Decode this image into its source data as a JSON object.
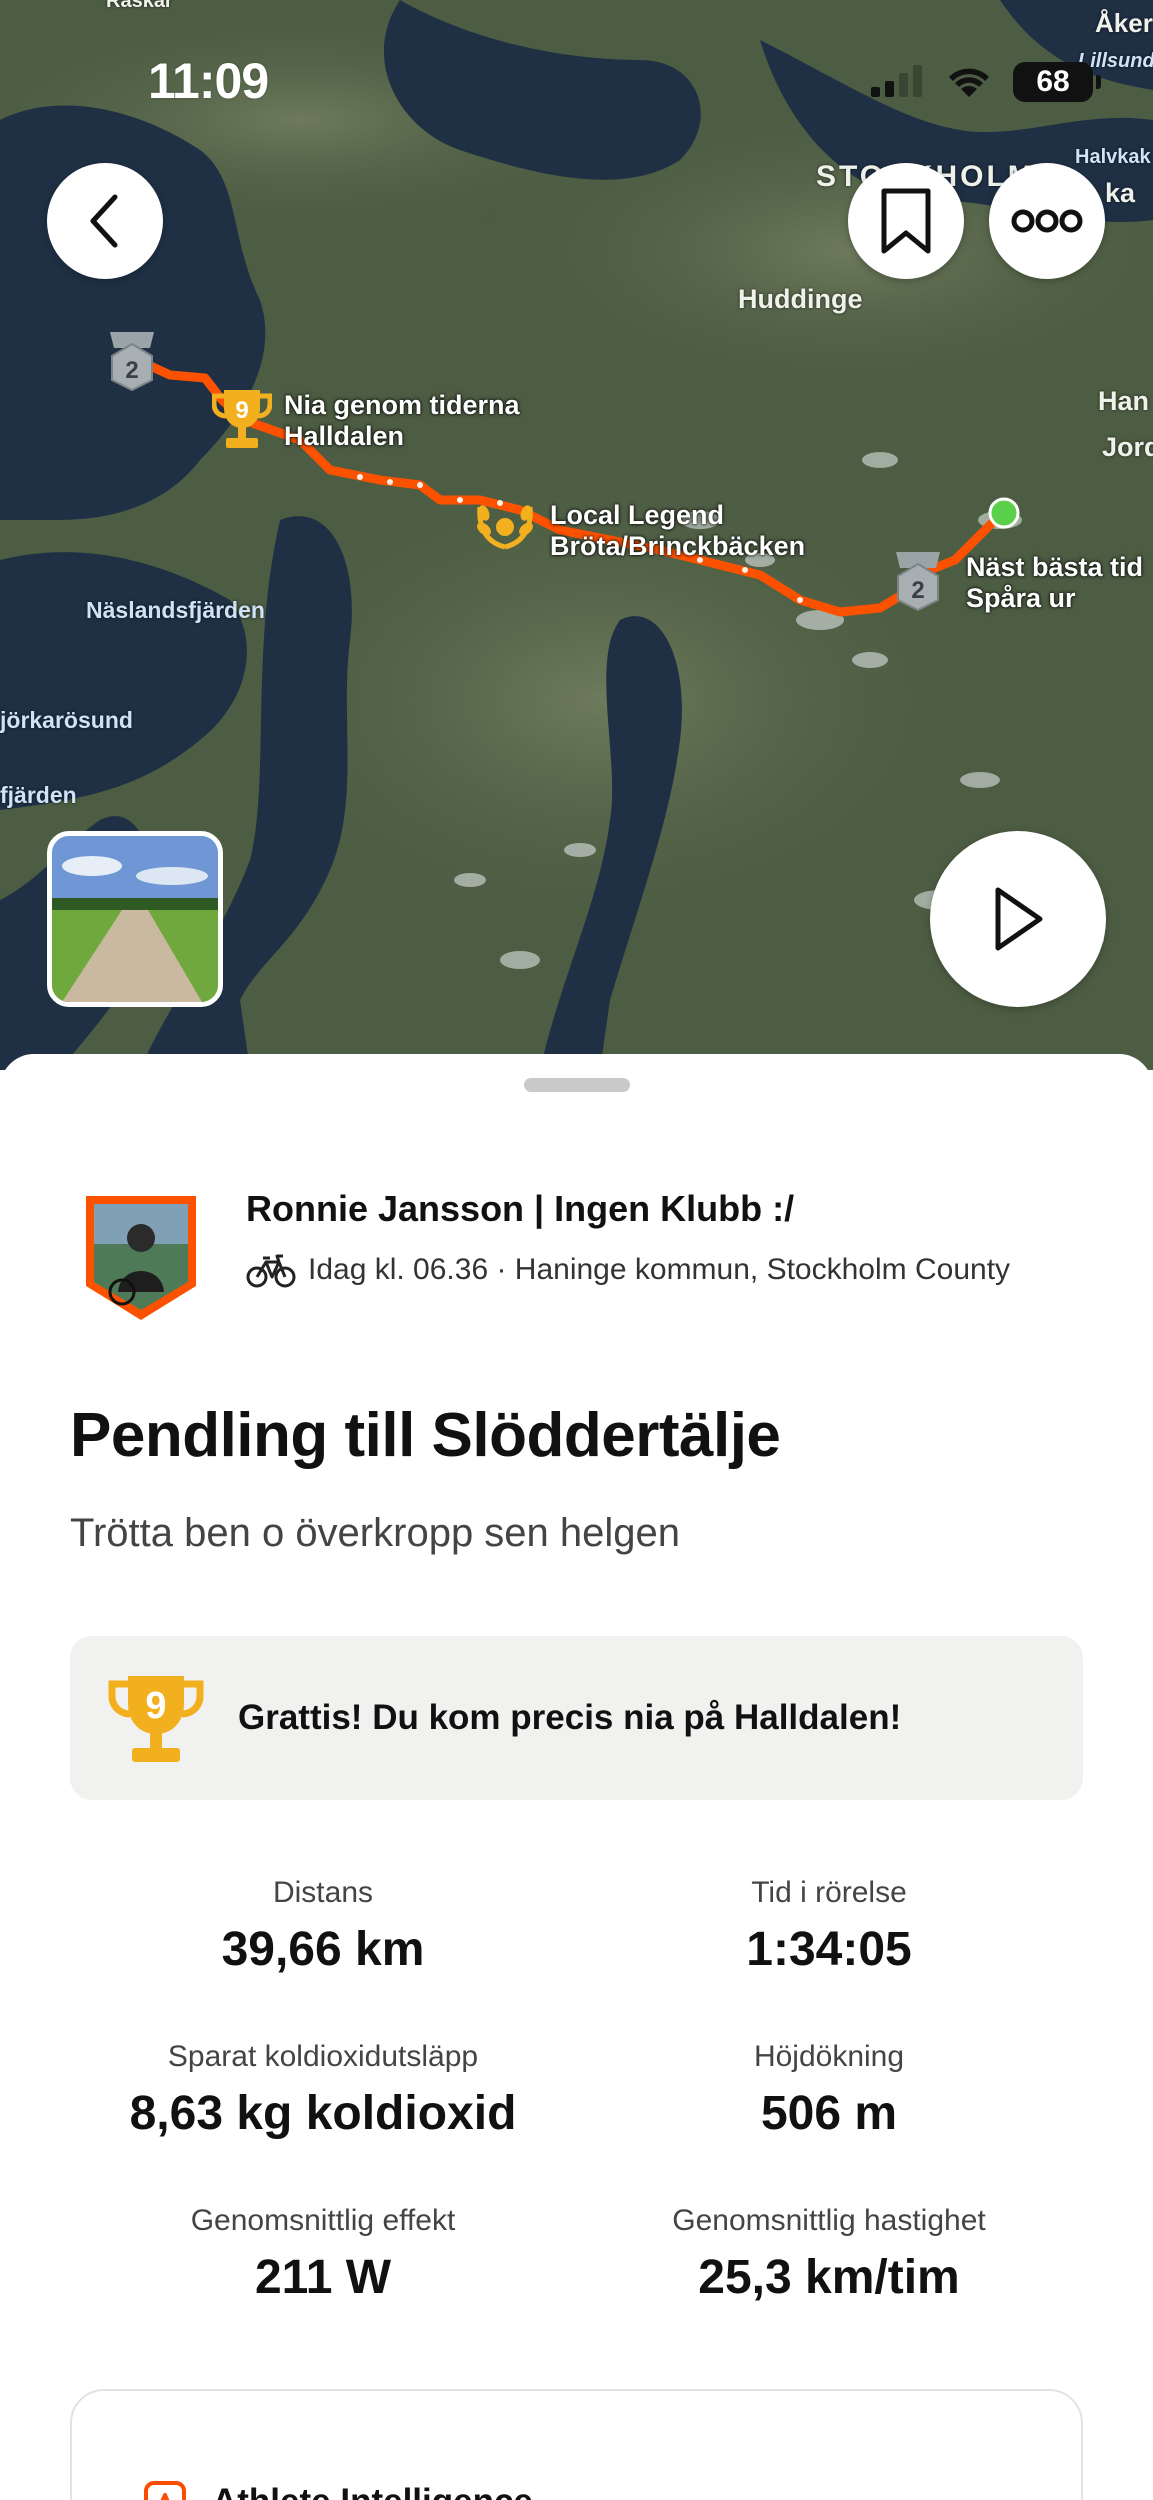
{
  "status_bar": {
    "time": "11:09",
    "battery": "68"
  },
  "map": {
    "labels": {
      "raskar": "Raskar",
      "akers": "Åker",
      "lillsunds": "Lillsund",
      "halvkakan": "Halvkak",
      "ka": "ka",
      "stockholm": "STOCKHOLM",
      "huddinge": "Huddinge",
      "han": "Han",
      "jord": "Jord",
      "naslandsfjarden": "Näslandsfjärden",
      "jorkarosund": "jörkarösund",
      "fjarden": "fjärden"
    },
    "segments": {
      "nia_line1": "Nia genom tiderna",
      "nia_line2": "Halldalen",
      "legend_line1": "Local Legend",
      "legend_line2": "Bröta/Brinckbäcken",
      "nast_line1": "Näst bästa tid",
      "nast_line2": "Spåra ur"
    },
    "badges": {
      "rank_2": "2",
      "rank_9": "9"
    }
  },
  "activity": {
    "athlete_name": "Ronnie Jansson | Ingen Klubb :/",
    "meta": "Idag kl. 06.36 · Haninge kommun, Stockholm County",
    "title": "Pendling till Slöddertälje",
    "description": "Trötta ben o överkropp sen helgen",
    "achievement": "Grattis! Du kom precis nia på Halldalen!",
    "achievement_rank": "9"
  },
  "stats": [
    {
      "label": "Distans",
      "value": "39,66 km"
    },
    {
      "label": "Tid i rörelse",
      "value": "1:34:05"
    },
    {
      "label": "Sparat koldioxidutsläpp",
      "value": "8,63 kg koldioxid"
    },
    {
      "label": "Höjdökning",
      "value": "506 m"
    },
    {
      "label": "Genomsnittlig effekt",
      "value": "211 W"
    },
    {
      "label": "Genomsnittlig hastighet",
      "value": "25,3 km/tim"
    }
  ],
  "athlete_intelligence": {
    "title": "Athlete Intelligence"
  },
  "colors": {
    "route": "#fc5200",
    "brand": "#fc4c02",
    "trophy": "#f2b01e",
    "sheet_card": "#f1f1ef"
  }
}
